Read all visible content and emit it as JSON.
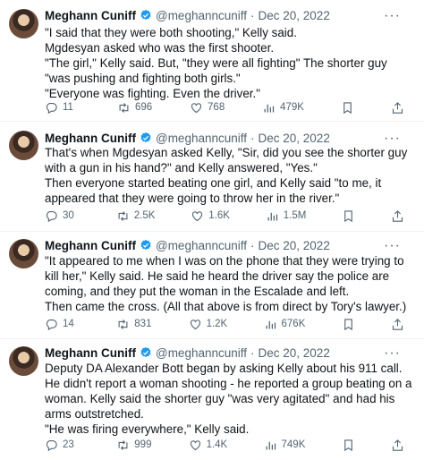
{
  "tweets": [
    {
      "name": "Meghann Cuniff",
      "handle": "@meghanncuniff",
      "date": "Dec 20, 2022",
      "lines": [
        "\"I said that they were both shooting,\" Kelly said.",
        "Mgdesyan asked who was the first shooter.",
        "\"The girl,\" Kelly said. But, \"they were all fighting\" The shorter guy \"was pushing and fighting both girls.\"",
        "\"Everyone was fighting. Even the driver.\""
      ],
      "replies": "11",
      "retweets": "696",
      "likes": "768",
      "views": "479K"
    },
    {
      "name": "Meghann Cuniff",
      "handle": "@meghanncuniff",
      "date": "Dec 20, 2022",
      "lines": [
        "That's when Mgdesyan asked Kelly, \"Sir, did you see the shorter guy with a gun in his hand?\" and Kelly answered, \"Yes.\"",
        "Then everyone started beating one girl, and Kelly said \"to me, it appeared that they were going to throw her in the river.\""
      ],
      "replies": "30",
      "retweets": "2.5K",
      "likes": "1.6K",
      "views": "1.5M"
    },
    {
      "name": "Meghann Cuniff",
      "handle": "@meghanncuniff",
      "date": "Dec 20, 2022",
      "lines": [
        "\"It appeared to me when I was on the phone that they were trying to kill her,\" Kelly said. He said he heard the driver say the police are coming, and they put the woman in the Escalade and left.",
        "Then came the cross. (All that above is from direct by Tory's lawyer.)"
      ],
      "replies": "14",
      "retweets": "831",
      "likes": "1.2K",
      "views": "676K"
    },
    {
      "name": "Meghann Cuniff",
      "handle": "@meghanncuniff",
      "date": "Dec 20, 2022",
      "lines": [
        "Deputy DA Alexander Bott began by asking Kelly about his 911 call. He didn't report a woman shooting - he reported a group beating on a woman. Kelly said the shorter guy \"was very agitated\" and had his arms outstretched.",
        "\"He was firing everywhere,\" Kelly said."
      ],
      "replies": "23",
      "retweets": "999",
      "likes": "1.4K",
      "views": "749K"
    }
  ],
  "colors": {
    "text": "#0f1419",
    "muted": "#536471",
    "verified": "#1d9bf0",
    "divider": "#eff3f4"
  },
  "icons": [
    "more-icon",
    "verified-badge-icon",
    "reply-icon",
    "retweet-icon",
    "like-icon",
    "views-icon",
    "bookmark-icon",
    "share-icon"
  ]
}
